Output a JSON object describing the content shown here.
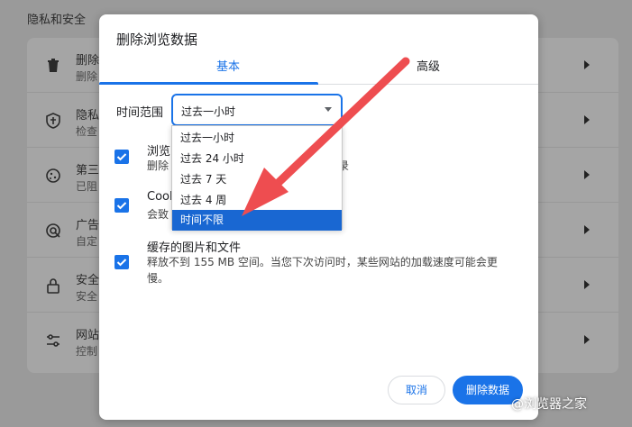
{
  "page": {
    "section_title": "隐私和安全"
  },
  "background_rows": [
    {
      "title": "删除浏",
      "desc": "删除",
      "icon": "trash-icon"
    },
    {
      "title": "隐私",
      "desc": "检查",
      "icon": "shield-icon"
    },
    {
      "title": "第三",
      "desc": "已阻",
      "icon": "cookie-icon"
    },
    {
      "title": "广告",
      "desc": "自定",
      "icon": "ad-privacy-icon"
    },
    {
      "title": "安全",
      "desc": "安全",
      "icon": "lock-icon"
    },
    {
      "title": "网站",
      "desc": "控制",
      "icon": "sliders-icon"
    }
  ],
  "dialog": {
    "title": "删除浏览数据",
    "tabs": {
      "basic": "基本",
      "advanced": "高级"
    },
    "time_range": {
      "label": "时间范围",
      "selected": "过去一小时",
      "options": [
        "过去一小时",
        "过去 24 小时",
        "过去 7 天",
        "过去 4 周",
        "时间不限"
      ],
      "highlighted": "时间不限"
    },
    "items": [
      {
        "title": "浏览",
        "desc": "删除",
        "desc_tail": "录",
        "checked": true
      },
      {
        "title": "Cook",
        "desc": "会致",
        "checked": true
      },
      {
        "title": "缓存的图片和文件",
        "desc": "释放不到 155 MB 空间。当您下次访问时，某些网站的加载速度可能会更慢。",
        "checked": true
      }
    ],
    "buttons": {
      "cancel": "取消",
      "delete": "删除数据"
    }
  },
  "watermark": "@浏览器之家",
  "colors": {
    "accent": "#1a73e8",
    "highlight": "#1967d2",
    "arrow": "#ee4d50"
  }
}
